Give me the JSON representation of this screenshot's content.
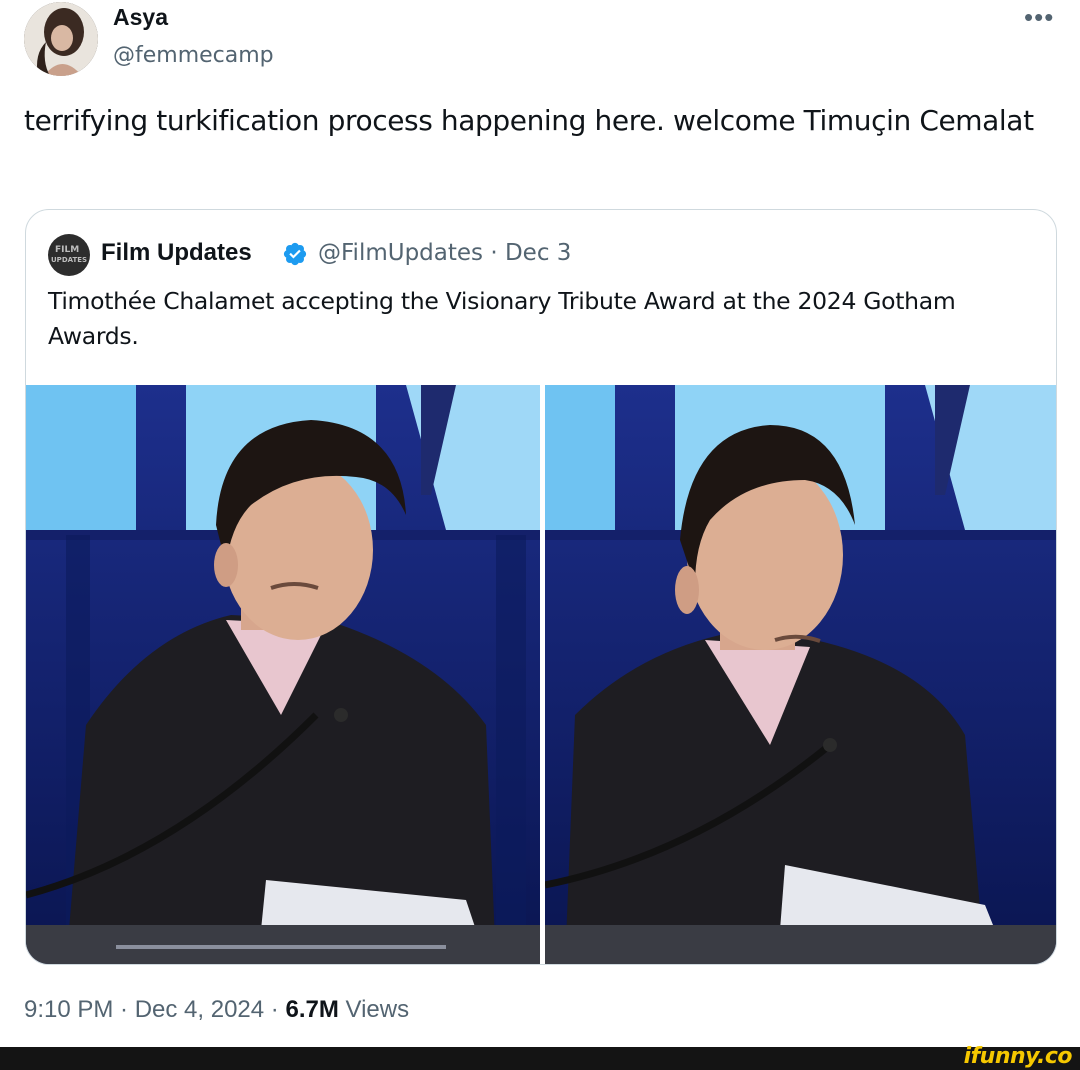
{
  "tweet": {
    "author_name": "Asya",
    "author_handle": "@femmecamp",
    "more_icon": "more-horizontal-icon",
    "text": "terrifying turkification process happening here. welcome Timuçin Cemalat",
    "timestamp": "9:10 PM · Dec 4, 2024 · ",
    "views_count": "6.7M",
    "views_label": " Views"
  },
  "quoted_tweet": {
    "author_name": "Film Updates",
    "avatar_text_line1": "FILM",
    "avatar_text_line2": "UPDATES",
    "verified_icon": "verified-badge-icon",
    "handle": "@FilmUpdates",
    "separator": "·",
    "date": "Dec 3",
    "text": "Timothée Chalamet accepting the Visionary Tribute Award at the 2024 Gotham Awards.",
    "images": [
      "photo-left",
      "photo-right"
    ]
  },
  "watermark": {
    "text": "ifunny.co"
  },
  "colors": {
    "text_primary": "#0f1419",
    "text_secondary": "#536471",
    "border": "#cfd9de",
    "verified_blue": "#1d9bf0",
    "watermark_yellow": "#f6c800",
    "stage_blue": "#1a2a8a"
  }
}
